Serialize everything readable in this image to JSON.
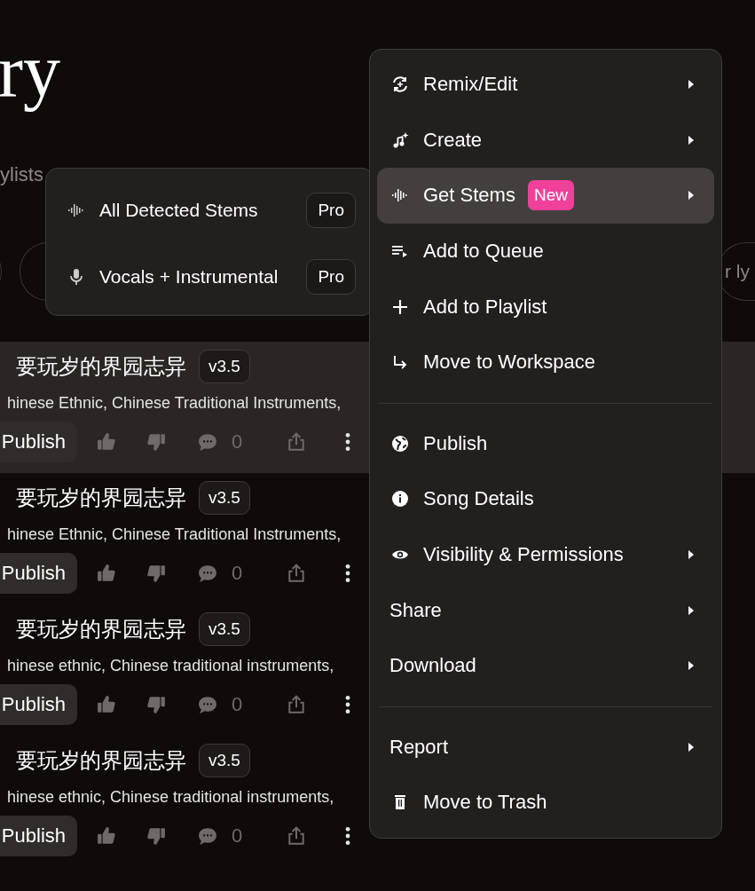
{
  "header": {
    "title": "ry",
    "tab": "ylists"
  },
  "filters": {
    "search_placeholder": "r ly"
  },
  "songs": [
    {
      "title": "要玩岁的界园志异",
      "version": "v3.5",
      "tags": "hinese Ethnic, Chinese Traditional Instruments,",
      "publish": "Publish",
      "comments": "0",
      "selected": true
    },
    {
      "title": "要玩岁的界园志异",
      "version": "v3.5",
      "tags": "hinese Ethnic, Chinese Traditional Instruments,",
      "publish": "Publish",
      "comments": "0",
      "selected": false
    },
    {
      "title": "要玩岁的界园志异",
      "version": "v3.5",
      "tags": "hinese ethnic, Chinese traditional instruments,",
      "publish": "Publish",
      "comments": "0",
      "selected": false
    },
    {
      "title": "要玩岁的界园志异",
      "version": "v3.5",
      "tags": "hinese ethnic, Chinese traditional instruments,",
      "publish": "Publish",
      "comments": "0",
      "selected": false
    }
  ],
  "context_menu": {
    "sections": [
      {
        "items": [
          {
            "label": "Remix/Edit",
            "has_submenu": true,
            "selected": false
          },
          {
            "label": "Create",
            "has_submenu": true,
            "selected": false
          },
          {
            "label": "Get Stems",
            "badge": "New",
            "has_submenu": true,
            "selected": true
          },
          {
            "label": "Add to Queue",
            "has_submenu": false,
            "selected": false
          },
          {
            "label": "Add to Playlist",
            "has_submenu": false,
            "selected": false
          },
          {
            "label": "Move to Workspace",
            "has_submenu": false,
            "selected": false
          }
        ]
      },
      {
        "items": [
          {
            "label": "Publish",
            "has_submenu": false,
            "selected": false
          },
          {
            "label": "Song Details",
            "has_submenu": false,
            "selected": false
          },
          {
            "label": "Visibility & Permissions",
            "has_submenu": true,
            "selected": false
          },
          {
            "label": "Share",
            "has_submenu": true,
            "selected": false
          },
          {
            "label": "Download",
            "has_submenu": true,
            "selected": false
          }
        ]
      },
      {
        "items": [
          {
            "label": "Report",
            "has_submenu": true,
            "selected": false
          },
          {
            "label": "Move to Trash",
            "has_submenu": false,
            "selected": false
          }
        ]
      }
    ]
  },
  "submenu": {
    "items": [
      {
        "label": "All Detected Stems",
        "badge": "Pro"
      },
      {
        "label": "Vocals + Instrumental",
        "badge": "Pro"
      }
    ]
  }
}
